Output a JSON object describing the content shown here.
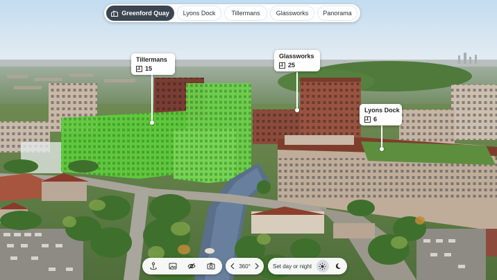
{
  "tabs": [
    {
      "label": "Greenford Quay",
      "active": true
    },
    {
      "label": "Lyons Dock",
      "active": false
    },
    {
      "label": "Tillermans",
      "active": false
    },
    {
      "label": "Glassworks",
      "active": false
    },
    {
      "label": "Panorama",
      "active": false
    }
  ],
  "callouts": {
    "tillermans": {
      "title": "Tillermans",
      "count": "15",
      "icon": "floorplan-icon"
    },
    "glassworks": {
      "title": "Glassworks",
      "count": "25",
      "icon": "floorplan-icon"
    },
    "lyons_dock": {
      "title": "Lyons Dock",
      "count": "6",
      "icon": "floorplan-icon"
    }
  },
  "toolbar": {
    "buttons": [
      "street-view-icon",
      "image-icon",
      "hide-view-icon",
      "camera-icon"
    ],
    "rotate_label": "360°",
    "daynight_label": "Set day or night",
    "day_icon": "sun-icon",
    "night_icon": "moon-icon"
  },
  "colors": {
    "active_tab": "#3c4650",
    "highlight_building": "#5fd03a",
    "sky": "#cfe3f3"
  }
}
